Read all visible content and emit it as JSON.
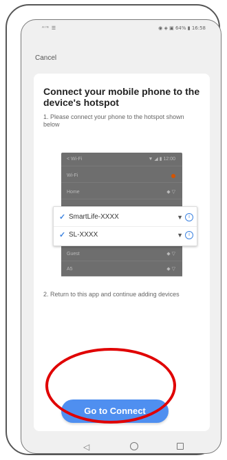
{
  "status_bar": {
    "left": "ᴬᴵᴺ ☰",
    "right": "◉ ◈ ▣ 64% ▮ 16:58"
  },
  "header": {
    "cancel_label": "Cancel"
  },
  "card": {
    "title": "Connect your mobile phone to the device's hotspot",
    "step1": "1. Please connect your phone to the hotspot shown below",
    "step2": "2. Return to this app and continue adding devices"
  },
  "wifi_list": {
    "rows": [
      {
        "label": "< Wi-Fi",
        "icons": "▼ ◢ ▮ 12:00"
      },
      {
        "label": "Wi-Fi",
        "icons": ""
      },
      {
        "label": "Home",
        "icons": "◆ ▽"
      }
    ],
    "bottom_rows": [
      {
        "label": "Guest",
        "icons": "◆ ▽"
      },
      {
        "label": "A5",
        "icons": "◆ ▽"
      }
    ]
  },
  "hotspots": [
    {
      "name": "SmartLife-XXXX"
    },
    {
      "name": "SL-XXXX"
    }
  ],
  "icons": {
    "check": "check-icon",
    "wifi": "wifi-icon",
    "info": "info-icon"
  },
  "actions": {
    "connect_label": "Go to Connect"
  },
  "colors": {
    "accent": "#4f8ff0",
    "highlight_ring": "#e00000"
  }
}
